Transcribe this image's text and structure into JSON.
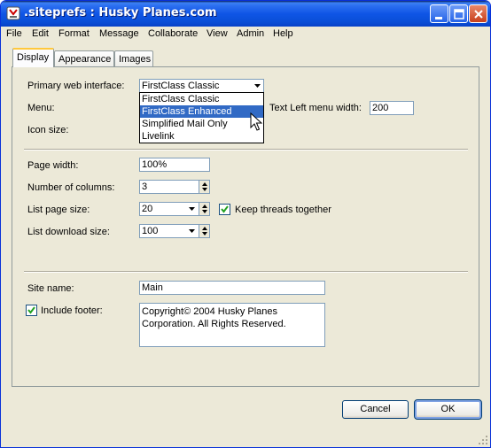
{
  "window": {
    "title": ".siteprefs : Husky Planes.com"
  },
  "menubar": {
    "items": [
      "File",
      "Edit",
      "Format",
      "Message",
      "Collaborate",
      "View",
      "Admin",
      "Help"
    ]
  },
  "tabs": [
    {
      "label": "Display",
      "active": true
    },
    {
      "label": "Appearance",
      "active": false
    },
    {
      "label": "Images",
      "active": false
    }
  ],
  "form": {
    "primary_web_interface": {
      "label": "Primary web interface:",
      "value": "FirstClass Classic",
      "options": [
        "FirstClass Classic",
        "FirstClass Enhanced",
        "Simplified Mail Only",
        "Livelink"
      ],
      "highlighted_option": "FirstClass Enhanced"
    },
    "menu": {
      "label": "Menu:"
    },
    "text_left_menu_width": {
      "label": "Text Left menu width:",
      "value": "200"
    },
    "icon_size": {
      "label": "Icon size:"
    },
    "page_width": {
      "label": "Page width:",
      "value": "100%"
    },
    "number_of_columns": {
      "label": "Number of columns:",
      "value": "3"
    },
    "list_page_size": {
      "label": "List page size:",
      "value": "20"
    },
    "keep_threads_together": {
      "label": "Keep threads together",
      "checked": true
    },
    "list_download_size": {
      "label": "List download size:",
      "value": "100"
    },
    "site_name": {
      "label": "Site name:",
      "value": "Main"
    },
    "include_footer": {
      "label": "Include footer:",
      "checked": true
    },
    "footer_text": {
      "line1": "Copyright© 2004 Husky Planes",
      "line2": "Corporation. All Rights Reserved."
    }
  },
  "buttons": {
    "cancel": "Cancel",
    "ok": "OK"
  },
  "colors": {
    "window_bg": "#ece9d8",
    "titlebar": "#0a4fd8",
    "selection": "#316ac5",
    "tab_accent": "#ffc83c"
  }
}
